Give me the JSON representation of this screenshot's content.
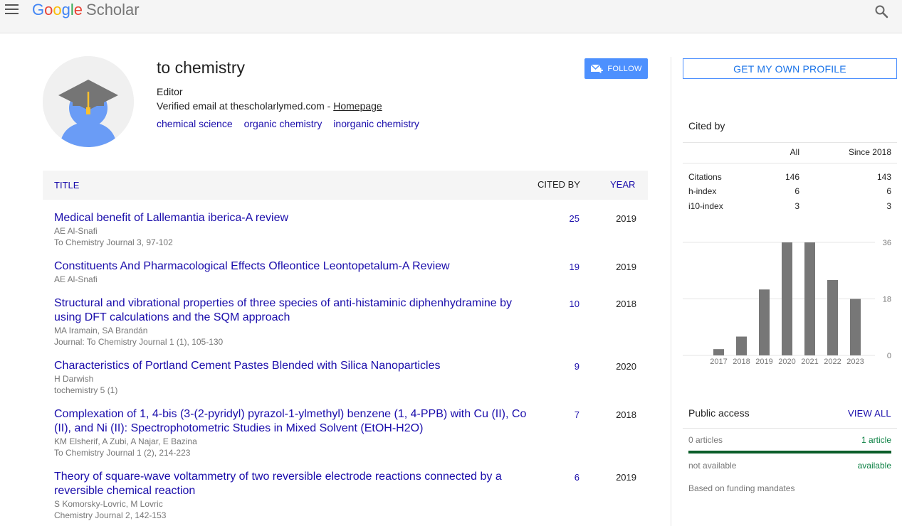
{
  "header": {
    "logo_google": [
      "G",
      "o",
      "o",
      "g",
      "l",
      "e"
    ],
    "logo_scholar": "Scholar"
  },
  "profile": {
    "name": "to chemistry",
    "affiliation": "Editor",
    "email_text": "Verified email at thescholarlymed.com - ",
    "homepage_link": "Homepage",
    "interests": [
      "chemical science",
      "organic chemistry",
      "inorganic chemistry"
    ],
    "follow_label": "FOLLOW"
  },
  "table": {
    "col_title": "TITLE",
    "col_cited": "CITED BY",
    "col_year": "YEAR",
    "rows": [
      {
        "title": "Medical benefit of Lallemantia iberica-A review",
        "authors": "AE Al-Snafi",
        "venue": "To Chemistry Journal 3, 97-102",
        "cited": "25",
        "year": "2019"
      },
      {
        "title": "Constituents And Pharmacological Effects Ofleontice Leontopetalum-A Review",
        "authors": "AE Al-Snafi",
        "venue": "",
        "cited": "19",
        "year": "2019"
      },
      {
        "title": "Structural and vibrational properties of three species of anti-histaminic diphenhydramine by using DFT calculations and the SQM approach",
        "authors": "MA Iramain, SA Brandán",
        "venue": "Journal: To Chemistry Journal 1 (1), 105-130",
        "cited": "10",
        "year": "2018"
      },
      {
        "title": "Characteristics of Portland Cement Pastes Blended with Silica Nanoparticles",
        "authors": "H Darwish",
        "venue": "tochemistry 5 (1)",
        "cited": "9",
        "year": "2020"
      },
      {
        "title": "Complexation of 1, 4-bis (3-(2-pyridyl) pyrazol-1-ylmethyl) benzene (1, 4-PPB) with Cu (II), Co (II), and Ni (II): Spectrophotometric Studies in Mixed Solvent (EtOH-H2O)",
        "authors": "KM Elsherif, A Zubi, A Najar, E Bazina",
        "venue": "To Chemistry Journal 1 (2), 214-223",
        "cited": "7",
        "year": "2018"
      },
      {
        "title": "Theory of square-wave voltammetry of two reversible electrode reactions connected by a reversible chemical reaction",
        "authors": "S Komorsky-Lovric, M Lovric",
        "venue": "Chemistry Journal 2, 142-153",
        "cited": "6",
        "year": "2019"
      }
    ]
  },
  "sidebar": {
    "get_profile_label": "GET MY OWN PROFILE",
    "cited_by_title": "Cited by",
    "col_all": "All",
    "col_since": "Since 2018",
    "metrics": [
      {
        "label": "Citations",
        "all": "146",
        "since": "143"
      },
      {
        "label": "h-index",
        "all": "6",
        "since": "6"
      },
      {
        "label": "i10-index",
        "all": "3",
        "since": "3"
      }
    ],
    "public_access_title": "Public access",
    "view_all_label": "VIEW ALL",
    "pa_left_count": "0 articles",
    "pa_right_count": "1 article",
    "pa_left_status": "not available",
    "pa_right_status": "available",
    "pa_footer": "Based on funding mandates",
    "pa_available_fraction": 1.0
  },
  "colors": {
    "link": "#1a0dab",
    "accent": "#4d90fe",
    "bar": "#777777",
    "available": "#0b8043"
  },
  "chart_data": {
    "type": "bar",
    "categories": [
      "2017",
      "2018",
      "2019",
      "2020",
      "2021",
      "2022",
      "2023"
    ],
    "values": [
      2,
      6,
      21,
      36,
      36,
      24,
      18
    ],
    "yticks": [
      "0",
      "18",
      "36"
    ],
    "ylim": [
      0,
      36
    ],
    "grid": true
  }
}
